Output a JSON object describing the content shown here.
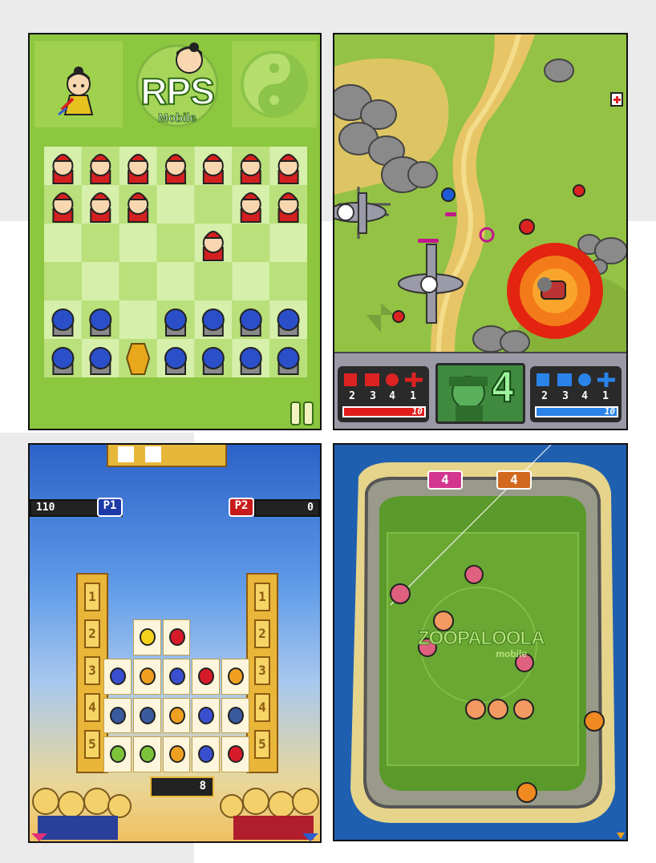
{
  "rps": {
    "logo_title": "RPS",
    "logo_subtitle": "Mobile"
  },
  "battle": {
    "red_counts": [
      "2",
      "3",
      "4",
      "1"
    ],
    "blue_counts": [
      "2",
      "3",
      "4",
      "1"
    ],
    "red_health": "10",
    "blue_health": "10",
    "center_number": "4"
  },
  "slots": {
    "p1_score": "110",
    "p1_label": "P1",
    "p2_label": "P2",
    "p2_score": "0",
    "reel_numbers": [
      "1",
      "2",
      "3",
      "4",
      "5"
    ],
    "bottom_counter": "8"
  },
  "zoo": {
    "score_left": "4",
    "score_right": "4",
    "logo_title": "ZOOPALOOLA",
    "logo_subtitle": "mobile"
  }
}
